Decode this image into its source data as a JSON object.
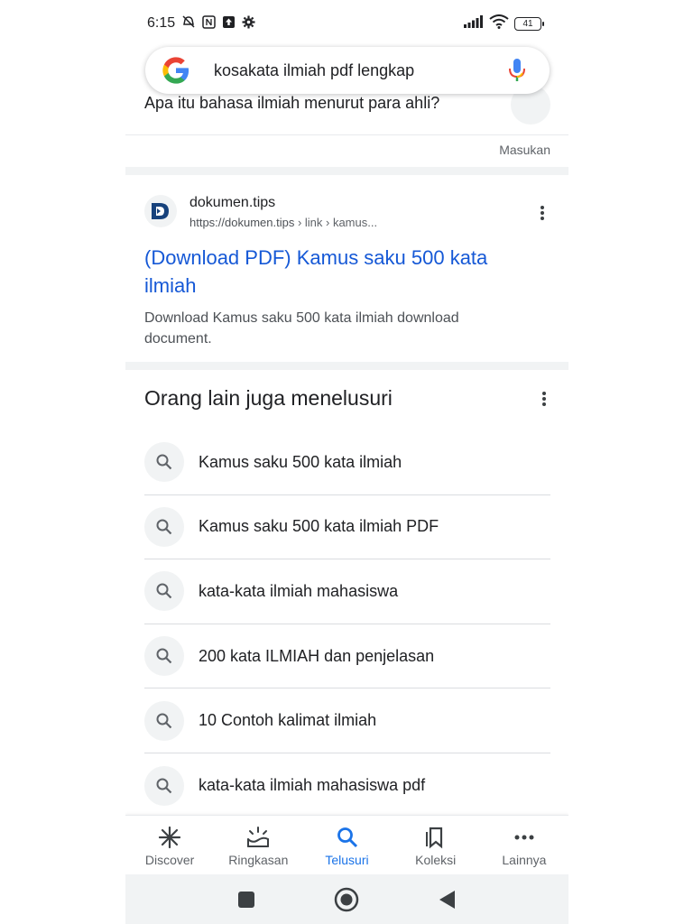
{
  "status_bar": {
    "time": "6:15",
    "battery": "41",
    "left_icons": [
      "mute-icon",
      "nfc-icon",
      "upload-icon",
      "gear-icon"
    ],
    "right_icons": [
      "signal-icon",
      "wifi-icon",
      "battery-icon"
    ]
  },
  "search": {
    "query": "kosakata ilmiah pdf lengkap"
  },
  "partial_question": "Apa itu bahasa ilmiah menurut para ahli?",
  "feedback_label": "Masukan",
  "result": {
    "site_name": "dokumen.tips",
    "url_base": "https://dokumen.tips",
    "url_path": " › link › kamus...",
    "title": "(Download PDF) Kamus saku 500 kata ilmiah",
    "snippet": "Download Kamus saku 500 kata ilmiah download document."
  },
  "people_also_search": {
    "title": "Orang lain juga menelusuri",
    "items": [
      "Kamus saku 500 kata ilmiah",
      "Kamus saku 500 kata ilmiah PDF",
      "kata-kata ilmiah mahasiswa",
      "200 kata ILMIAH dan penjelasan",
      "10 Contoh kalimat ilmiah",
      "kata-kata ilmiah mahasiswa pdf"
    ]
  },
  "bottom_nav": {
    "items": [
      {
        "label": "Discover",
        "icon": "asterisk-icon"
      },
      {
        "label": "Ringkasan",
        "icon": "sunrise-icon"
      },
      {
        "label": "Telusuri",
        "icon": "search-icon",
        "active": true
      },
      {
        "label": "Koleksi",
        "icon": "bookmark-icon"
      },
      {
        "label": "Lainnya",
        "icon": "more-horizontal-icon"
      }
    ]
  },
  "colors": {
    "link": "#1558d6",
    "active": "#1a73e8",
    "text": "#202124",
    "secondary": "#5f6368"
  }
}
